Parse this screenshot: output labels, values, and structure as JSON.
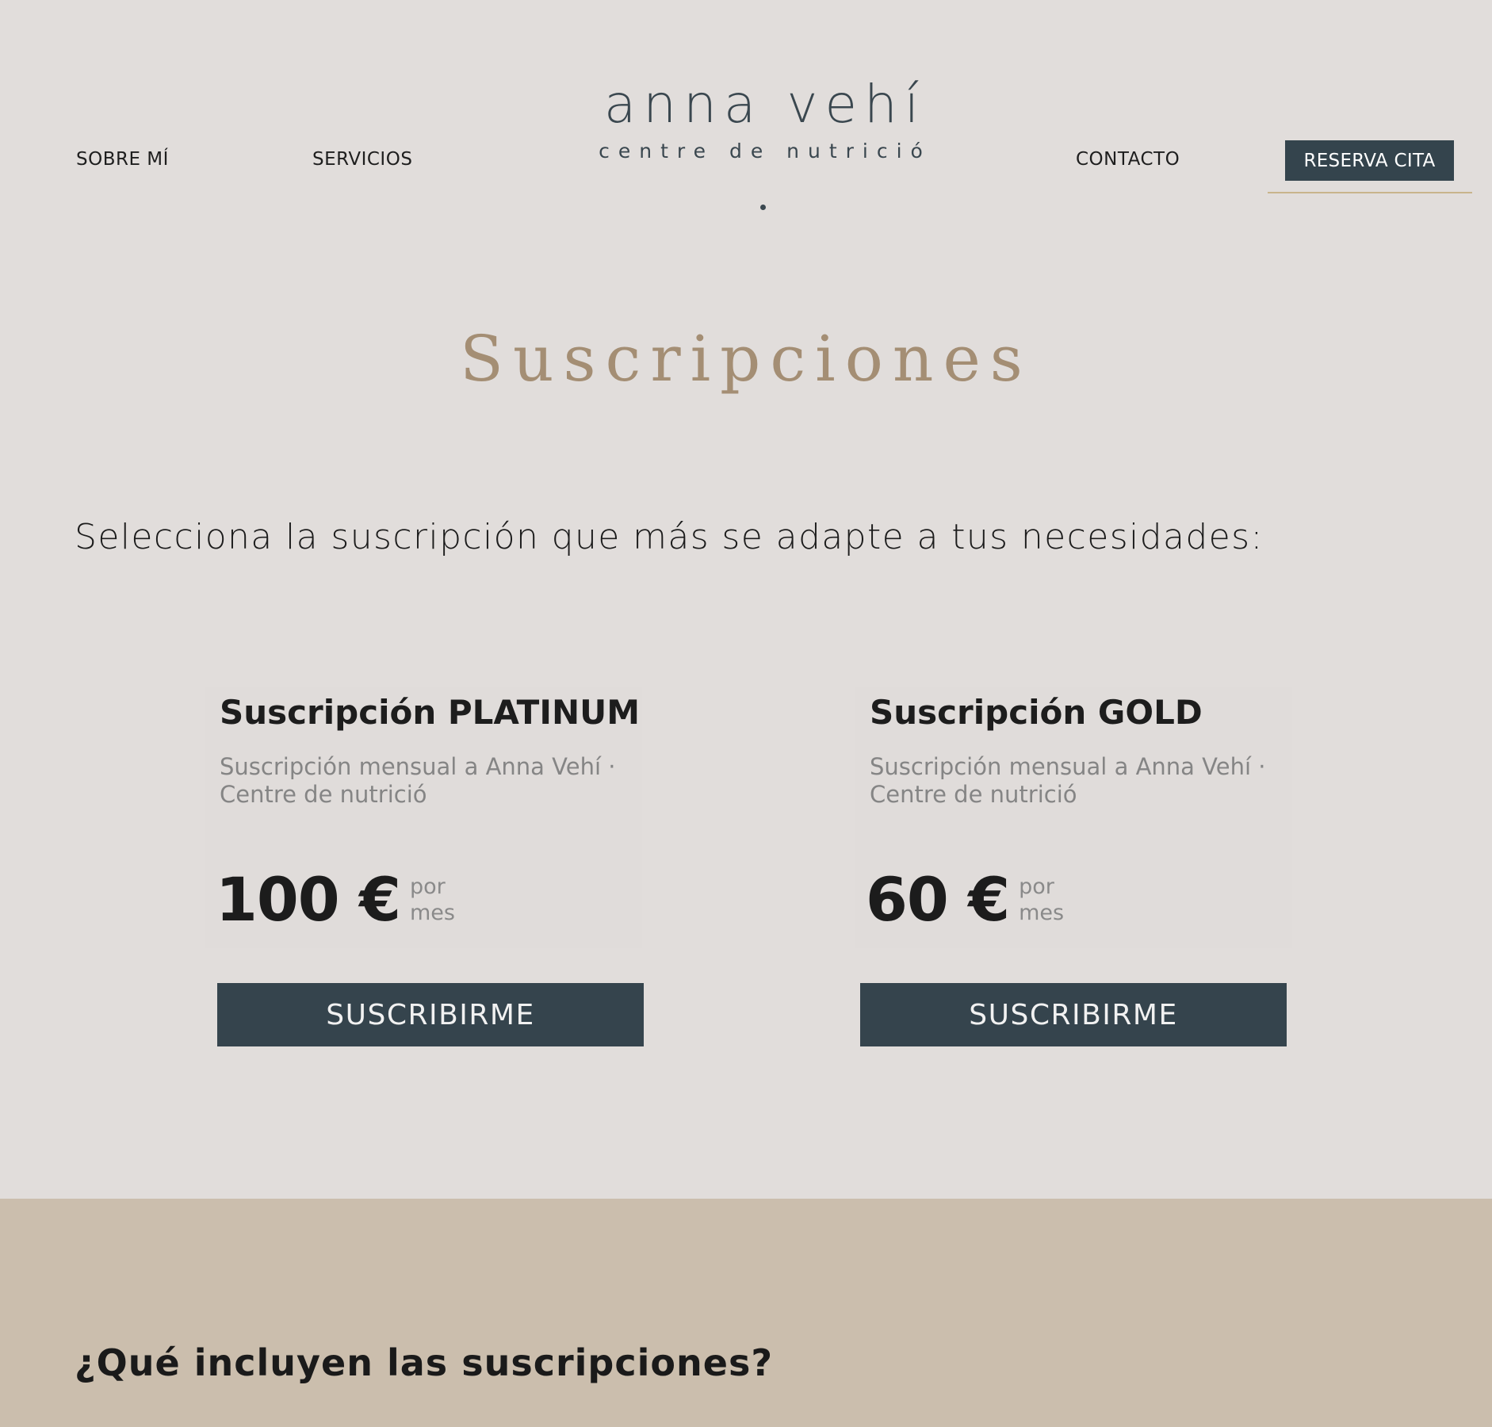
{
  "nav": {
    "sobre_mi": "SOBRE MÍ",
    "servicios": "SERVICIOS",
    "contacto": "CONTACTO",
    "reserva_cita": "RESERVA CITA"
  },
  "logo": {
    "name": "anna vehí",
    "subtitle": "centre de nutrició"
  },
  "main": {
    "title": "Suscripciones",
    "intro": "Selecciona la suscripción que más se adapte a tus necesidades:",
    "plans": [
      {
        "title": "Suscripción PLATINUM",
        "description": "Suscripción mensual a Anna Vehí · Centre de nutrició",
        "price": "100 €",
        "period_line1": "por",
        "period_line2": "mes",
        "button": "SUSCRIBIRME"
      },
      {
        "title": "Suscripción GOLD",
        "description": "Suscripción mensual a Anna Vehí · Centre de nutrició",
        "price": "60 €",
        "period_line1": "por",
        "period_line2": "mes",
        "button": "SUSCRIBIRME"
      }
    ]
  },
  "bottom": {
    "heading": "¿Qué incluyen las suscripciones?"
  },
  "colors": {
    "background": "#e1dddb",
    "dark_slate": "#34444d",
    "title_gold": "#a48e74",
    "band_beige": "#cbbead",
    "underline_gold": "#c8b48c"
  }
}
